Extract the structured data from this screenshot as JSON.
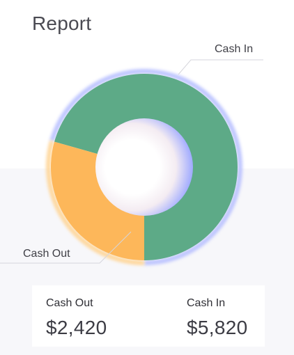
{
  "header": {
    "title": "Report"
  },
  "chart_data": {
    "type": "pie",
    "variant": "donut",
    "categories": [
      "Cash In",
      "Cash Out"
    ],
    "values": [
      5820,
      2420
    ],
    "colors": {
      "Cash In": "#5daa87",
      "Cash Out": "#fdb75a"
    },
    "labels": [
      "Cash In",
      "Cash Out"
    ]
  },
  "summary": {
    "cash_out": {
      "label": "Cash Out",
      "value": "$2,420"
    },
    "cash_in": {
      "label": "Cash In",
      "value": "$5,820"
    }
  }
}
